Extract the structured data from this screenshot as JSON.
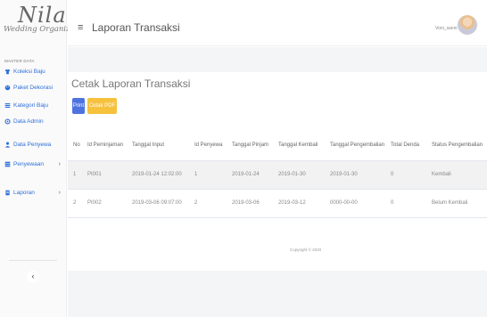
{
  "brand": {
    "logo_big": "Nila",
    "logo_small": "Wedding Organizer"
  },
  "sidebar": {
    "section_label": "MASTER DATA",
    "items": [
      {
        "label": "Koleksi Baju",
        "icon": "tshirt-icon",
        "has_submenu": false
      },
      {
        "label": "Paket Dekorasi",
        "icon": "palette-icon",
        "has_submenu": false
      },
      {
        "label": "Kategori Baju",
        "icon": "list-icon",
        "has_submenu": false
      },
      {
        "label": "Data Admin",
        "icon": "users-cog-icon",
        "has_submenu": false
      },
      {
        "label": "Data Penyewa",
        "icon": "user-icon",
        "has_submenu": false
      },
      {
        "label": "Penyewaan",
        "icon": "table-icon",
        "has_submenu": true
      },
      {
        "label": "Laporan",
        "icon": "report-icon",
        "has_submenu": true
      }
    ],
    "collapse_icon": "‹"
  },
  "topbar": {
    "title": "Laporan Transaksi",
    "menu_icon": "≡",
    "username": "Voni_sanni"
  },
  "page": {
    "title": "Cetak Laporan Transaksi",
    "print_label": "Print",
    "pdf_label": "Cetak PDF"
  },
  "table": {
    "headers": [
      "No",
      "Id Peminjaman",
      "Tanggal Input",
      "Id Penyewa",
      "Tanggal Pinjam",
      "Tanggal Kembali",
      "Tanggal Pengembalian",
      "Total Denda",
      "Status Pengembalian"
    ],
    "rows": [
      [
        "1",
        "PI001",
        "2019-01-24 12:02:00",
        "1",
        "2019-01-24",
        "2019-01-30",
        "2019-01-30",
        "0",
        "Kembali"
      ],
      [
        "2",
        "PI002",
        "2019-03-06 09:07:00",
        "2",
        "2019-03-06",
        "2019-03-12",
        "0000-00-00",
        "0",
        "Belum Kembali"
      ]
    ]
  },
  "footer": {
    "copyright": "Copyright © 2020"
  },
  "colors": {
    "accent": "#4e73df",
    "warning": "#f6c23e",
    "nav_link": "#2d6fd8"
  }
}
